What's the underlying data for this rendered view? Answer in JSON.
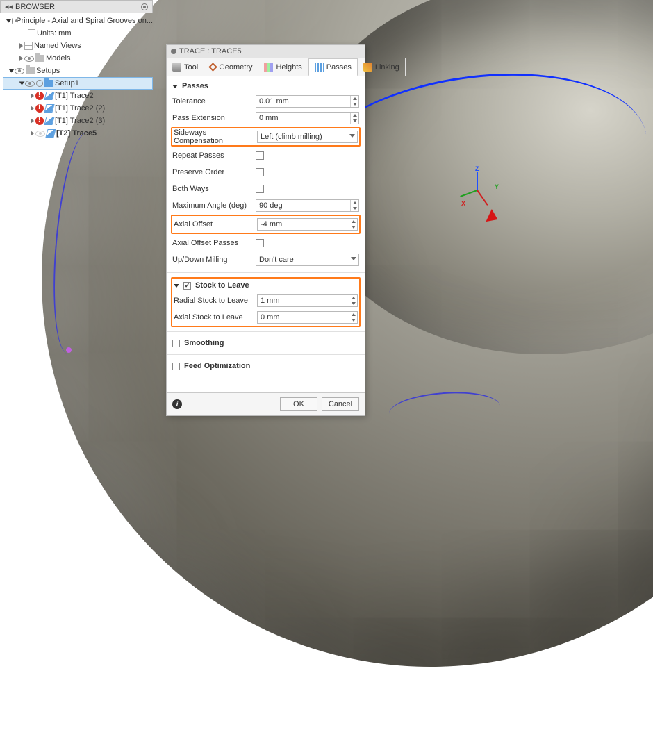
{
  "browser": {
    "header": "BROWSER",
    "root": "Principle - Axial and Spiral Grooves on...",
    "units": "Units: mm",
    "named_views": "Named Views",
    "models": "Models",
    "setups": "Setups",
    "setup1": "Setup1",
    "ops": [
      "[T1] Trace2",
      "[T1] Trace2 (2)",
      "[T1] Trace2 (3)",
      "[T2] Trace5"
    ]
  },
  "dialog": {
    "title": "TRACE : TRACE5",
    "tabs": {
      "tool": "Tool",
      "geometry": "Geometry",
      "heights": "Heights",
      "passes": "Passes",
      "linking": "Linking"
    },
    "passes": {
      "header": "Passes",
      "tolerance": {
        "label": "Tolerance",
        "value": "0.01 mm"
      },
      "pass_ext": {
        "label": "Pass Extension",
        "value": "0 mm"
      },
      "side_comp": {
        "label": "Sideways Compensation",
        "value": "Left (climb milling)"
      },
      "repeat": {
        "label": "Repeat Passes"
      },
      "preserve": {
        "label": "Preserve Order"
      },
      "both": {
        "label": "Both Ways"
      },
      "max_angle": {
        "label": "Maximum Angle (deg)",
        "value": "90 deg"
      },
      "axial_off": {
        "label": "Axial Offset",
        "value": "-4 mm"
      },
      "axial_pass": {
        "label": "Axial Offset Passes"
      },
      "updown": {
        "label": "Up/Down Milling",
        "value": "Don't care"
      }
    },
    "stock": {
      "header": "Stock to Leave",
      "radial": {
        "label": "Radial Stock to Leave",
        "value": "1 mm"
      },
      "axial": {
        "label": "Axial Stock to Leave",
        "value": "0 mm"
      }
    },
    "smoothing": "Smoothing",
    "feedopt": "Feed Optimization",
    "ok": "OK",
    "cancel": "Cancel"
  },
  "triad": {
    "x": "X",
    "y": "Y",
    "z": "Z"
  }
}
